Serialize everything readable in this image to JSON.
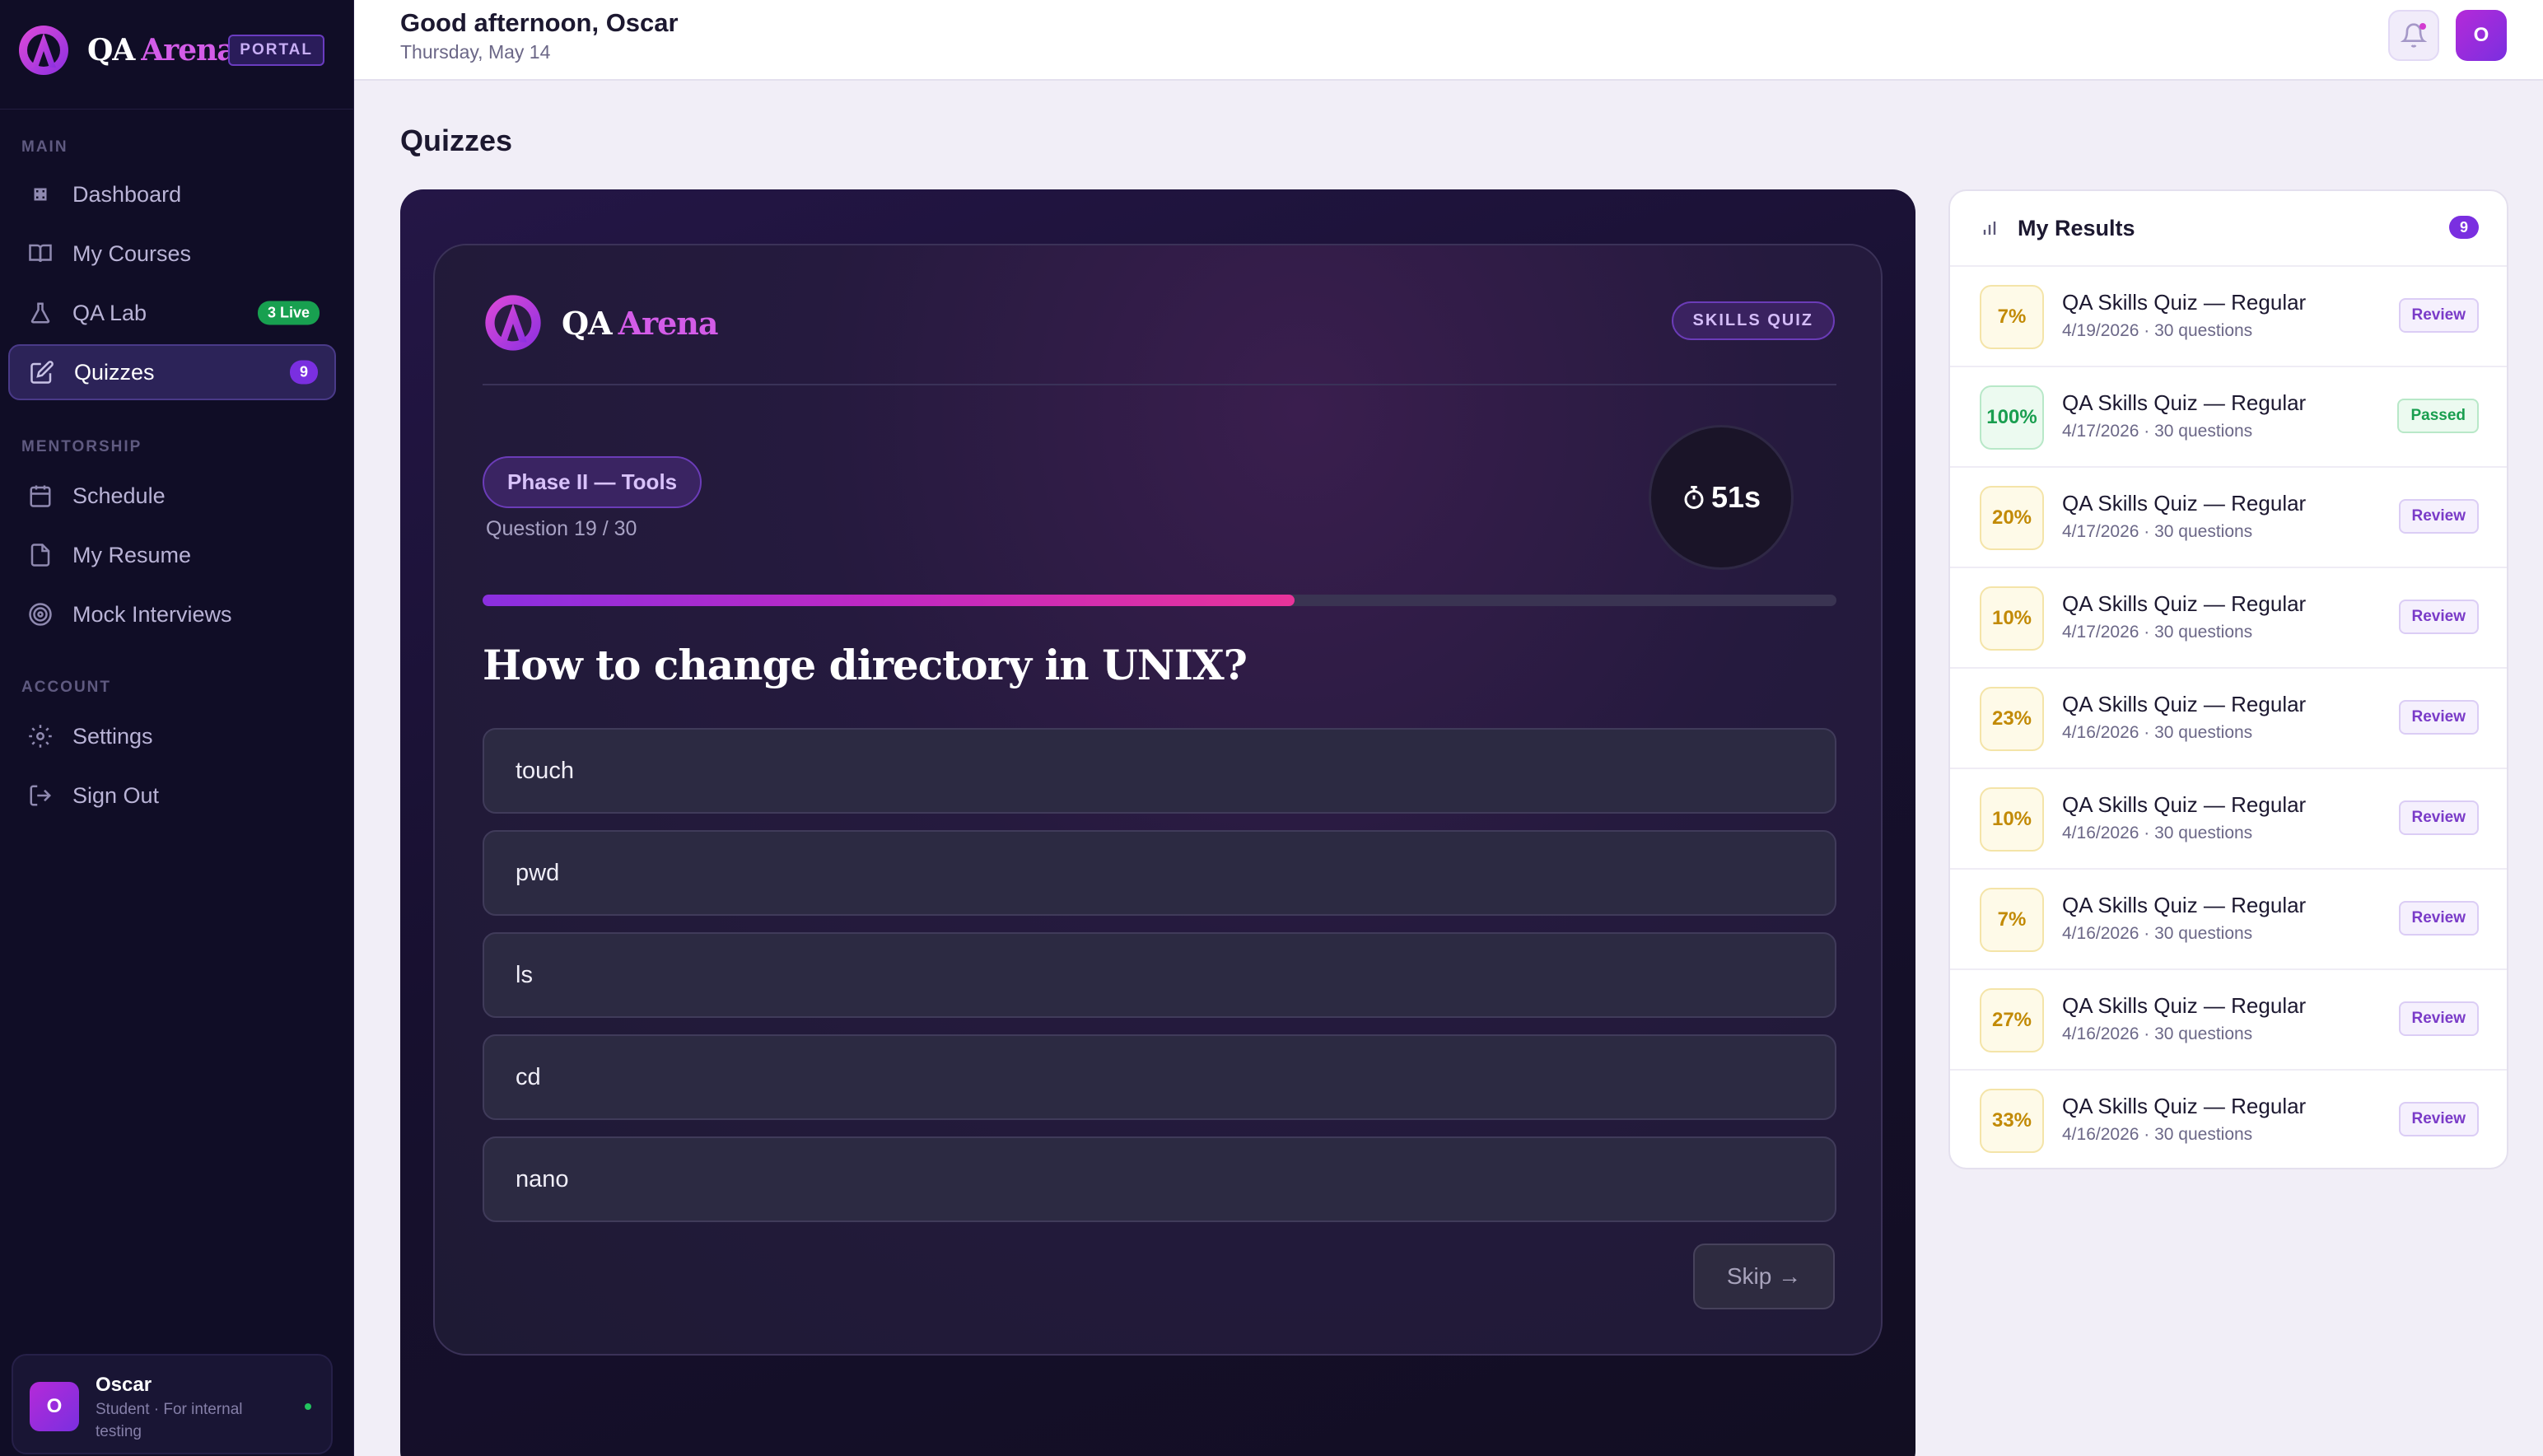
{
  "brand": {
    "name": "QA",
    "accent": "Arena",
    "portal_badge": "PORTAL"
  },
  "sidebar": {
    "sections": [
      {
        "label": "MAIN"
      },
      {
        "label": "MENTORSHIP"
      },
      {
        "label": "ACCOUNT"
      }
    ],
    "items": [
      {
        "label": "Dashboard",
        "icon": "grid-icon"
      },
      {
        "label": "My Courses",
        "icon": "book-icon"
      },
      {
        "label": "QA Lab",
        "icon": "flask-icon",
        "badge": "3 Live"
      },
      {
        "label": "Quizzes",
        "icon": "edit-icon",
        "badge": "9",
        "active": true
      },
      {
        "label": "Schedule",
        "icon": "calendar-icon"
      },
      {
        "label": "My Resume",
        "icon": "document-icon"
      },
      {
        "label": "Mock Interviews",
        "icon": "target-icon"
      },
      {
        "label": "Settings",
        "icon": "gear-icon"
      },
      {
        "label": "Sign Out",
        "icon": "sign-out-icon"
      }
    ],
    "user": {
      "initial": "O",
      "name": "Oscar",
      "role": "Student · For internal testing"
    }
  },
  "header": {
    "greeting": "Good afternoon, Oscar",
    "date": "Thursday, May 14",
    "avatar_initial": "O"
  },
  "page": {
    "title": "Quizzes"
  },
  "quiz": {
    "brand_name": "QA",
    "brand_accent": "Arena",
    "badge": "SKILLS QUIZ",
    "phase": "Phase II — Tools",
    "question_counter": "Question 19 / 30",
    "timer": "51s",
    "progress": 0.6,
    "question": "How to change directory in UNIX?",
    "options": [
      "touch",
      "pwd",
      "ls",
      "cd",
      "nano"
    ],
    "skip_label": "Skip →"
  },
  "results": {
    "title": "My Results",
    "count": "9",
    "items": [
      {
        "score": "7%",
        "title": "QA Skills Quiz — Regular",
        "meta": "4/19/2026 · 30 questions",
        "action": "Review",
        "passed": false
      },
      {
        "score": "100%",
        "title": "QA Skills Quiz — Regular",
        "meta": "4/17/2026 · 30 questions",
        "action": "Passed",
        "passed": true
      },
      {
        "score": "20%",
        "title": "QA Skills Quiz — Regular",
        "meta": "4/17/2026 · 30 questions",
        "action": "Review",
        "passed": false
      },
      {
        "score": "10%",
        "title": "QA Skills Quiz — Regular",
        "meta": "4/17/2026 · 30 questions",
        "action": "Review",
        "passed": false
      },
      {
        "score": "23%",
        "title": "QA Skills Quiz — Regular",
        "meta": "4/16/2026 · 30 questions",
        "action": "Review",
        "passed": false
      },
      {
        "score": "10%",
        "title": "QA Skills Quiz — Regular",
        "meta": "4/16/2026 · 30 questions",
        "action": "Review",
        "passed": false
      },
      {
        "score": "7%",
        "title": "QA Skills Quiz — Regular",
        "meta": "4/16/2026 · 30 questions",
        "action": "Review",
        "passed": false
      },
      {
        "score": "27%",
        "title": "QA Skills Quiz — Regular",
        "meta": "4/16/2026 · 30 questions",
        "action": "Review",
        "passed": false
      },
      {
        "score": "33%",
        "title": "QA Skills Quiz — Regular",
        "meta": "4/16/2026 · 30 questions",
        "action": "Review",
        "passed": false
      }
    ]
  },
  "colors": {
    "sidebar_bg": "#100d26",
    "accent": "#7a2fe0",
    "brand_pink": "#d35ce8",
    "pass_green": "#199e4f",
    "warn_amber": "#c28a05"
  }
}
